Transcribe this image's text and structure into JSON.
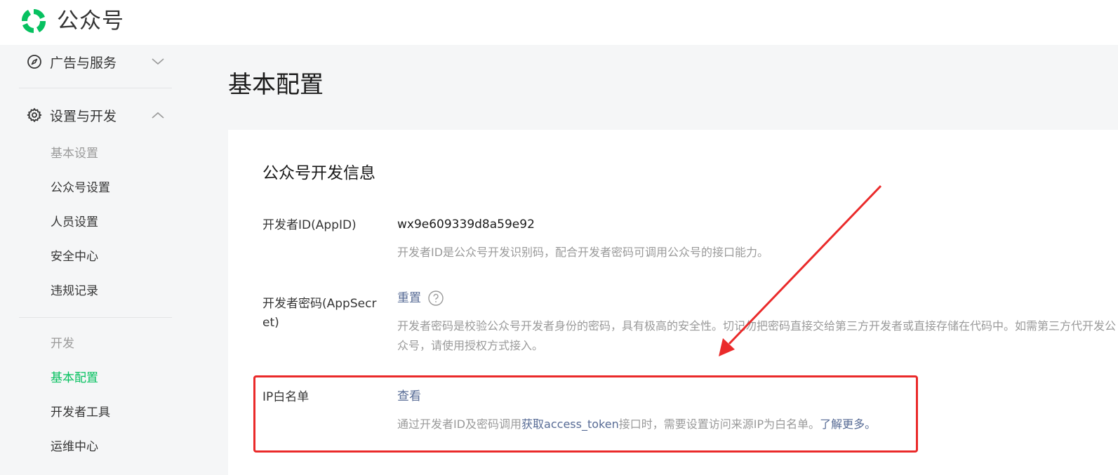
{
  "header": {
    "brand_name": "公众号",
    "logo_icon": "wechat-official-account-logo",
    "brand_color": "#07c160"
  },
  "sidebar": {
    "groups": [
      {
        "label": "广告与服务",
        "icon": "compass-icon",
        "expanded": false
      },
      {
        "label": "设置与开发",
        "icon": "gear-icon",
        "expanded": true
      }
    ],
    "settings_items": [
      {
        "label": "基本设置",
        "muted": true
      },
      {
        "label": "公众号设置"
      },
      {
        "label": "人员设置"
      },
      {
        "label": "安全中心"
      },
      {
        "label": "违规记录"
      }
    ],
    "dev_section_label": "开发",
    "dev_items": [
      {
        "label": "基本配置",
        "active": true
      },
      {
        "label": "开发者工具"
      },
      {
        "label": "运维中心"
      }
    ],
    "active_color": "#07c160"
  },
  "main": {
    "page_title": "基本配置",
    "section_title": "公众号开发信息",
    "rows": {
      "appid": {
        "label": "开发者ID(AppID)",
        "value": "wx9e609339d8a59e92",
        "desc": "开发者ID是公众号开发识别码，配合开发者密码可调用公众号的接口能力。"
      },
      "secret": {
        "label": "开发者密码(AppSecret)",
        "action": "重置",
        "help_icon": "question-circle-icon",
        "desc": "开发者密码是校验公众号开发者身份的密码，具有极高的安全性。切记勿把密码直接交给第三方开发者或直接存储在代码中。如需第三方代开发公众号，请使用授权方式接入。"
      },
      "ip_whitelist": {
        "label": "IP白名单",
        "action": "查看",
        "desc_prefix": "通过开发者ID及密码调用",
        "desc_link": "获取access_token",
        "desc_middle": "接口时，需要设置访问来源IP为白名单。",
        "desc_more": "了解更多。"
      }
    },
    "link_color": "#576b95"
  },
  "annotation": {
    "color": "#ea2a2a"
  }
}
